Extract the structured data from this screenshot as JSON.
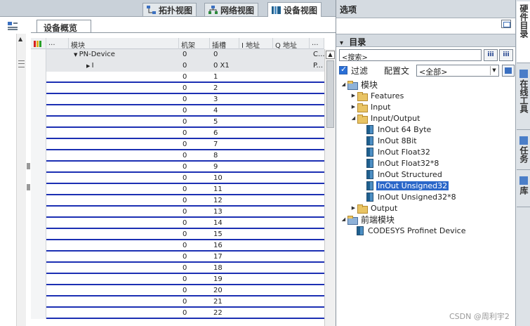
{
  "view_tabs": {
    "topology": "拓扑视图",
    "network": "网络视图",
    "device": "设备视图"
  },
  "overview_tab": "设备概览",
  "grid": {
    "headers": {
      "module": "模块",
      "rack": "机架",
      "slot": "插槽",
      "i_addr": "I 地址",
      "q_addr": "Q 地址",
      "more": "..."
    },
    "rows": [
      {
        "name": "PN-Device",
        "rack": "0",
        "slot": "0",
        "extra": "C..."
      },
      {
        "name": "I",
        "rack": "0",
        "slot": "0 X1",
        "extra": "P..."
      },
      {
        "name": "",
        "rack": "0",
        "slot": "1"
      },
      {
        "name": "",
        "rack": "0",
        "slot": "2"
      },
      {
        "name": "",
        "rack": "0",
        "slot": "3"
      },
      {
        "name": "",
        "rack": "0",
        "slot": "4"
      },
      {
        "name": "",
        "rack": "0",
        "slot": "5"
      },
      {
        "name": "",
        "rack": "0",
        "slot": "6"
      },
      {
        "name": "",
        "rack": "0",
        "slot": "7"
      },
      {
        "name": "",
        "rack": "0",
        "slot": "8"
      },
      {
        "name": "",
        "rack": "0",
        "slot": "9"
      },
      {
        "name": "",
        "rack": "0",
        "slot": "10"
      },
      {
        "name": "",
        "rack": "0",
        "slot": "11"
      },
      {
        "name": "",
        "rack": "0",
        "slot": "12"
      },
      {
        "name": "",
        "rack": "0",
        "slot": "13"
      },
      {
        "name": "",
        "rack": "0",
        "slot": "14"
      },
      {
        "name": "",
        "rack": "0",
        "slot": "15"
      },
      {
        "name": "",
        "rack": "0",
        "slot": "16"
      },
      {
        "name": "",
        "rack": "0",
        "slot": "17"
      },
      {
        "name": "",
        "rack": "0",
        "slot": "18"
      },
      {
        "name": "",
        "rack": "0",
        "slot": "19"
      },
      {
        "name": "",
        "rack": "0",
        "slot": "20"
      },
      {
        "name": "",
        "rack": "0",
        "slot": "21"
      },
      {
        "name": "",
        "rack": "0",
        "slot": "22"
      }
    ]
  },
  "options": {
    "title": "选项",
    "catalog_title": "目录",
    "search_placeholder": "<搜索>",
    "search_btn_1": "iii",
    "search_btn_2": "iii",
    "filter_label": "过滤",
    "profile_label": "配置文",
    "profile_value": "<全部>"
  },
  "tree": [
    {
      "label": "模块",
      "level": 0,
      "twisty": "open",
      "icon": "folder-blue",
      "big": true
    },
    {
      "label": "Features",
      "level": 1,
      "twisty": "closed",
      "icon": "folder"
    },
    {
      "label": "Input",
      "level": 1,
      "twisty": "closed",
      "icon": "folder"
    },
    {
      "label": "Input/Output",
      "level": 1,
      "twisty": "open",
      "icon": "folder"
    },
    {
      "label": "InOut 64 Byte",
      "level": 2,
      "icon": "module"
    },
    {
      "label": "InOut 8Bit",
      "level": 2,
      "icon": "module"
    },
    {
      "label": "InOut Float32",
      "level": 2,
      "icon": "module"
    },
    {
      "label": "InOut Float32*8",
      "level": 2,
      "icon": "module"
    },
    {
      "label": "InOut Structured",
      "level": 2,
      "icon": "module"
    },
    {
      "label": "InOut Unsigned32",
      "level": 2,
      "icon": "module",
      "selected": true
    },
    {
      "label": "InOut Unsigned32*8",
      "level": 2,
      "icon": "module"
    },
    {
      "label": "Output",
      "level": 1,
      "twisty": "closed",
      "icon": "folder"
    },
    {
      "label": "前端模块",
      "level": 0,
      "twisty": "open",
      "icon": "folder-blue",
      "big": true
    },
    {
      "label": "CODESYS Profinet Device",
      "level": 1,
      "icon": "module"
    }
  ],
  "side_tabs": [
    {
      "label": "硬件目录",
      "active": true
    },
    {
      "label": "在线工具"
    },
    {
      "label": "任务"
    },
    {
      "label": "库"
    }
  ],
  "watermark": "CSDN @周利宇2"
}
